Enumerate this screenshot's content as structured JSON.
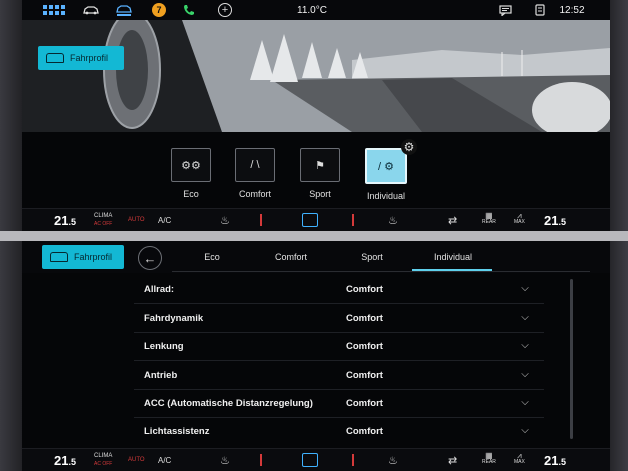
{
  "top_screen": {
    "status_bar": {
      "temperature": "11.0°C",
      "time": "12:52",
      "notification_badge": "7",
      "icons": [
        "apps-grid-icon",
        "car-icon",
        "drive-select-icon",
        "notification-icon",
        "phone-icon",
        "add-icon",
        "message-icon",
        "quick-settings-icon"
      ]
    },
    "profile_button": "Fahrprofil",
    "modes": [
      {
        "label": "Eco",
        "glyph": "⚙⚙",
        "active": false
      },
      {
        "label": "Comfort",
        "glyph": "/ \\",
        "active": false
      },
      {
        "label": "Sport",
        "glyph": "⚑",
        "active": false
      },
      {
        "label": "Individual",
        "glyph": "/ ⚙",
        "active": true
      }
    ]
  },
  "bottom_screen": {
    "profile_button": "Fahrprofil",
    "tabs": [
      {
        "label": "Eco",
        "active": false
      },
      {
        "label": "Comfort",
        "active": false
      },
      {
        "label": "Sport",
        "active": false
      },
      {
        "label": "Individual",
        "active": true
      }
    ],
    "settings": [
      {
        "label": "Allrad:",
        "value": "Comfort"
      },
      {
        "label": "Fahrdynamik",
        "value": "Comfort"
      },
      {
        "label": "Lenkung",
        "value": "Comfort"
      },
      {
        "label": "Antrieb",
        "value": "Comfort"
      },
      {
        "label": "ACC (Automatische Distanzregelung)",
        "value": "Comfort"
      },
      {
        "label": "Lichtassistenz",
        "value": "Comfort"
      }
    ]
  },
  "climate_bar": {
    "left_temp": "21",
    "left_temp_decimal": ".5",
    "right_temp": "21",
    "right_temp_decimal": ".5",
    "clima_label": "CLIMA",
    "clima_sub": "AC OFF",
    "auto_label": "AUTO",
    "ac_label": "A/C",
    "rear_label": "REAR",
    "max_label": "MAX"
  },
  "colors": {
    "accent": "#13b8d4",
    "active_mode": "#8ad6ec",
    "tab_underline": "#5fd0ec"
  }
}
